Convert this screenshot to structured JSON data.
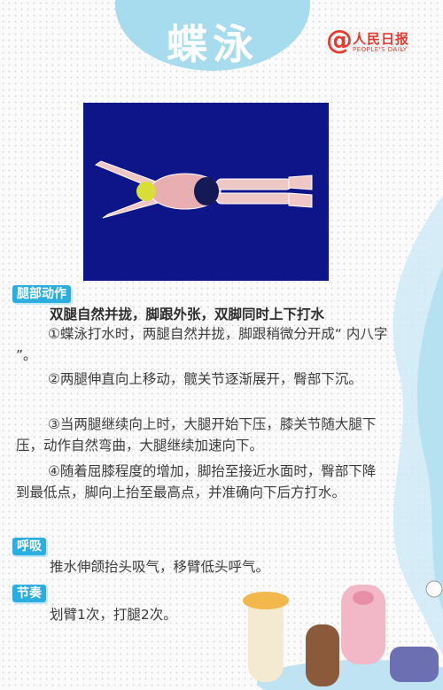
{
  "header": {
    "title": "蝶泳"
  },
  "logo": {
    "at": "@",
    "name": "人民日报",
    "sub": "PEOPLE'S DAILY"
  },
  "sections": {
    "legs": {
      "tag": "腿部动作",
      "headline": "双腿自然并拢，脚跟外张，双脚同时上下打水",
      "steps": [
        "①蝶泳打水时，两腿自然并拢，脚跟稍微分开成“ 内八字 ”。",
        "②两腿伸直向上移动，髋关节逐渐展开，臀部下沉。",
        "③当两腿继续向上时，大腿开始下压，膝关节随大腿下压，动作自然弯曲，大腿继续加速向下。",
        "④随着屈膝程度的增加，脚抬至接近水面时，臀部下降到最低点，脚向上抬至最高点，并准确向下后方打水。"
      ]
    },
    "breathing": {
      "tag": "呼吸",
      "text": "推水伸颌抬头吸气，移臂低头呼气。"
    },
    "rhythm": {
      "tag": "节奏",
      "text": "划臂1次，打腿2次。"
    }
  },
  "colors": {
    "accent": "#2aaee0",
    "bubble": "#a6dced",
    "video_bg": "#0d1589",
    "logo_red": "#e43b30"
  }
}
